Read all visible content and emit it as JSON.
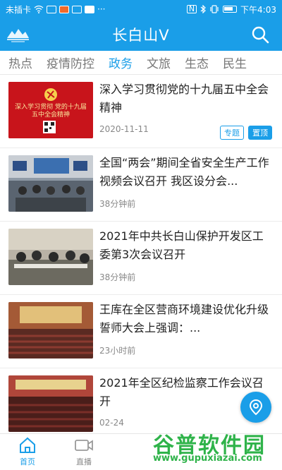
{
  "status_bar": {
    "carrier": "未插卡",
    "icons_left": [
      "wifi-icon",
      "notification-icon",
      "notification-icon",
      "notification-icon",
      "notification-icon",
      "more-icon"
    ],
    "icons_right": [
      "nfc-icon",
      "bluetooth-icon",
      "vibrate-icon",
      "battery-icon"
    ],
    "time": "下午4:03"
  },
  "header": {
    "title": "长白山V",
    "accent_color": "#1a9ee8"
  },
  "tabs": [
    {
      "label": "热点",
      "active": false
    },
    {
      "label": "疫情防控",
      "active": false
    },
    {
      "label": "政务",
      "active": true
    },
    {
      "label": "文旅",
      "active": false
    },
    {
      "label": "生态",
      "active": false
    },
    {
      "label": "民生",
      "active": false
    }
  ],
  "articles": [
    {
      "title": "深入学习贯彻党的十九届五中全会精神",
      "meta": "2020-11-11",
      "tag1": "专题",
      "tag2": "置顶",
      "thumb_caption": "深入学习贯彻 党的十九届五中全会精神"
    },
    {
      "title": "全国“两会”期间全省安全生产工作视频会议召开 我区设分会...",
      "meta": "38分钟前"
    },
    {
      "title": "2021年中共长白山保护开发区工委第3次会议召开",
      "meta": "38分钟前"
    },
    {
      "title": "王库在全区营商环境建设优化升级誓师大会上强调：...",
      "meta": "23小时前"
    },
    {
      "title": "2021年全区纪检监察工作会议召开",
      "meta": "02-24"
    }
  ],
  "bottom_nav": [
    {
      "label": "首页",
      "icon": "home-icon",
      "active": true
    },
    {
      "label": "直播",
      "icon": "video-icon",
      "active": false
    }
  ],
  "watermark": {
    "text": "谷普软件园",
    "url": "www.gupuxiazai.com"
  }
}
